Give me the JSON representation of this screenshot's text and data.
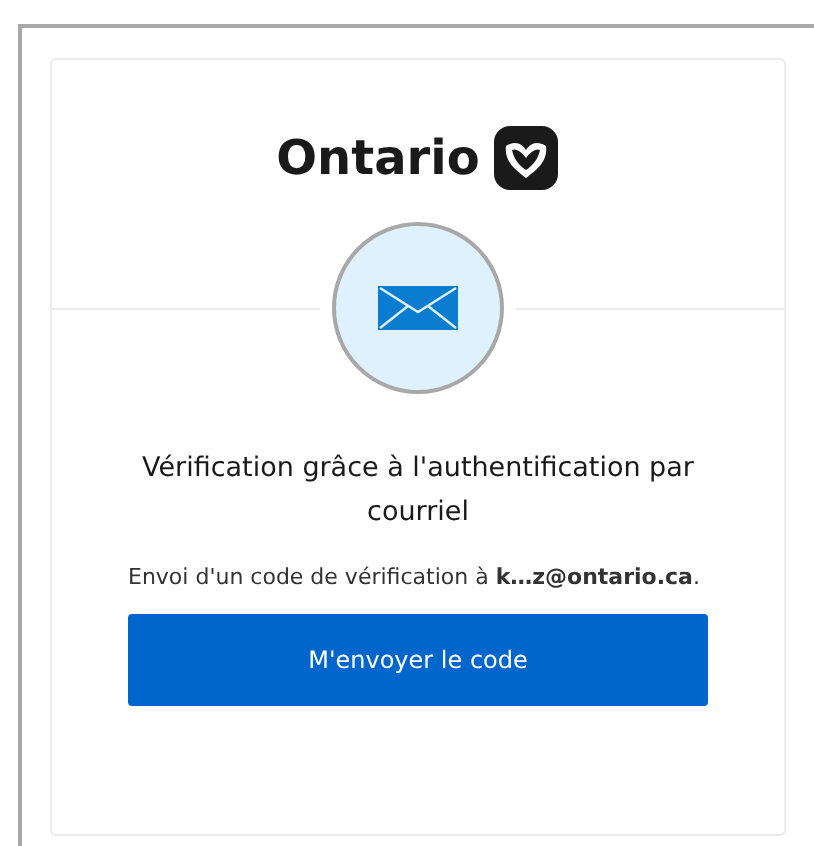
{
  "logo": {
    "text": "Ontario"
  },
  "title": "Vérification grâce à l'authentification par courriel",
  "message": "Envoi d'un code de vérification à **k…z@ontario.ca**.",
  "button": {
    "label": "M'envoyer le code"
  }
}
